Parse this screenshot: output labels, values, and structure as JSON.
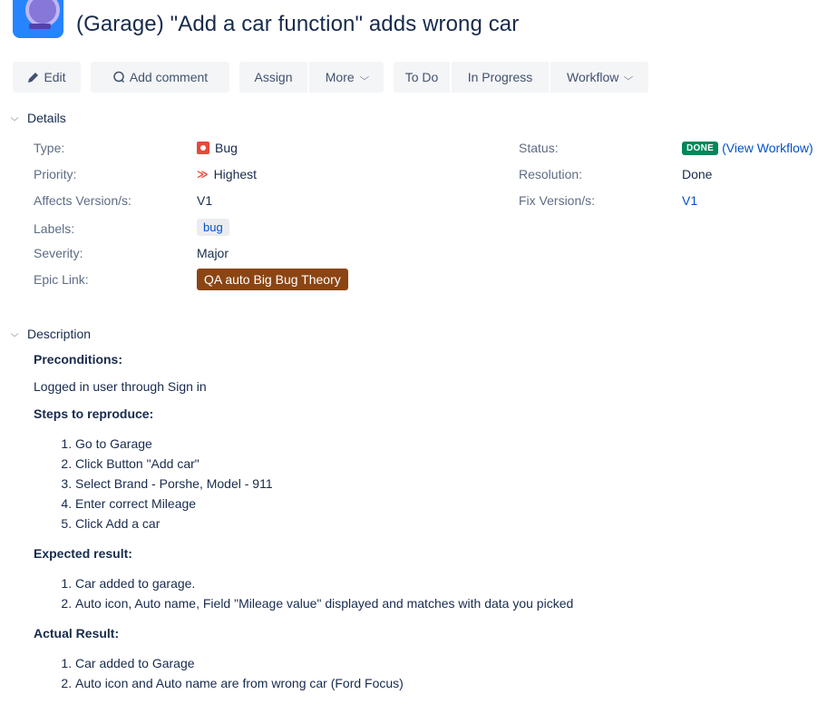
{
  "issue": {
    "title": "(Garage) \"Add a car function\" adds wrong car"
  },
  "toolbar": {
    "edit": "Edit",
    "add_comment": "Add comment",
    "assign": "Assign",
    "more": "More",
    "to_do": "To Do",
    "in_progress": "In Progress",
    "workflow": "Workflow"
  },
  "details": {
    "section_label": "Details",
    "left_fields": [
      {
        "label": "Type:",
        "value": "Bug",
        "icon": "bug-icon"
      },
      {
        "label": "Priority:",
        "value": "Highest",
        "icon": "priority-highest-icon"
      },
      {
        "label": "Affects Version/s:",
        "value": "V1"
      },
      {
        "label": "Labels:",
        "value": "bug"
      },
      {
        "label": "Severity:",
        "value": "Major"
      },
      {
        "label": "Epic Link:",
        "value": "QA auto Big Bug Theory"
      }
    ],
    "right_fields": [
      {
        "label": "Status:",
        "value": "DONE",
        "link": "(View Workflow)"
      },
      {
        "label": "Resolution:",
        "value": "Done"
      },
      {
        "label": "Fix Version/s:",
        "value": "V1"
      }
    ]
  },
  "description": {
    "section_label": "Description",
    "preconditions_heading": "Preconditions:",
    "preconditions_text": "Logged in user through Sign in",
    "steps_heading": "Steps to reproduce:",
    "steps": [
      "Go to Garage",
      "Click Button \"Add car\"",
      "Select Brand - Porshe, Model - 911",
      "Enter correct Mileage",
      "Click Add a car"
    ],
    "expected_heading": "Expected result:",
    "expected": [
      "Car added to garage.",
      "Auto icon, Auto name, Field \"Mileage value\" displayed and matches with data you picked"
    ],
    "actual_heading": "Actual Result:",
    "actual": [
      "Car added to Garage",
      "Auto icon and Auto name are from wrong car (Ford Focus)"
    ]
  },
  "colors": {
    "accent": "#0052cc",
    "done_lozenge": "#00875a",
    "epic": "#8b4513",
    "bug": "#e5493a"
  }
}
